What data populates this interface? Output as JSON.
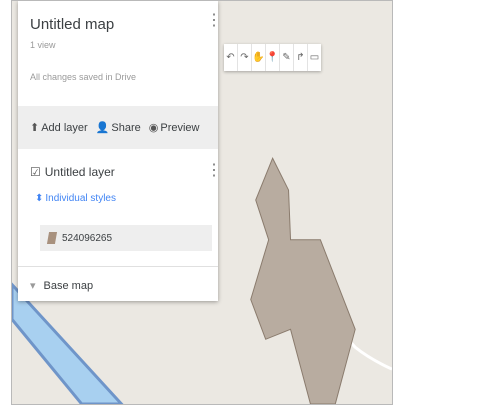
{
  "panel": {
    "title": "Untitled map",
    "views": "1 view",
    "save_status": "All changes saved in Drive",
    "actions": {
      "add_layer": "Add layer",
      "share": "Share",
      "preview": "Preview"
    },
    "layer": {
      "name": "Untitled layer",
      "checked": true,
      "styles_link": "Individual styles",
      "feature_name": "524096265"
    },
    "base_map_label": "Base map"
  },
  "toolbar": {
    "buttons": [
      {
        "icon": "undo-icon",
        "glyph": "↶"
      },
      {
        "icon": "redo-icon",
        "glyph": "↷"
      },
      {
        "icon": "hand-icon",
        "glyph": "✋"
      },
      {
        "icon": "marker-icon",
        "glyph": "📍"
      },
      {
        "icon": "draw-line-icon",
        "glyph": "✎"
      },
      {
        "icon": "directions-icon",
        "glyph": "↱"
      },
      {
        "icon": "ruler-icon",
        "glyph": "▭"
      }
    ]
  },
  "colors": {
    "map_background": "#ebe8e2",
    "river": "#a8d0f0",
    "river_edge": "#6f95c9",
    "polygon_fill": "#b8aca0",
    "polygon_stroke": "#8a7b6d",
    "link_blue": "#4285f4"
  }
}
